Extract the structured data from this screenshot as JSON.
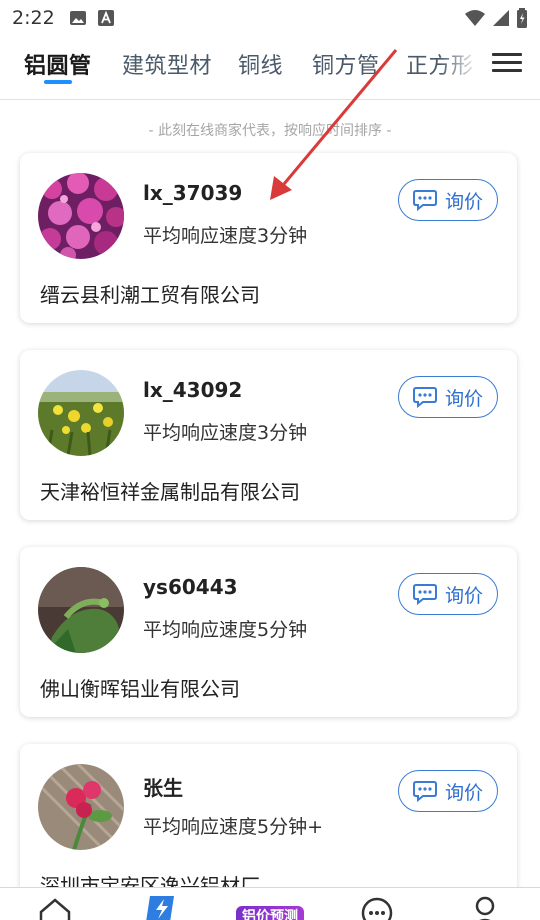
{
  "status_bar": {
    "time": "2:22"
  },
  "tabs": [
    {
      "label": "铝圆管",
      "active": true
    },
    {
      "label": "建筑型材",
      "active": false
    },
    {
      "label": "铜线",
      "active": false
    },
    {
      "label": "铜方管",
      "active": false
    },
    {
      "label": "正方形",
      "active": false
    }
  ],
  "section": {
    "subtitle": "- 此刻在线商家代表，按响应时间排序 -"
  },
  "merchants": [
    {
      "name": "lx_37039",
      "response_time": "平均响应速度3分钟",
      "company": "缙云县利潮工贸有限公司",
      "inquiry_label": "询价"
    },
    {
      "name": "lx_43092",
      "response_time": "平均响应速度3分钟",
      "company": "天津裕恒祥金属制品有限公司",
      "inquiry_label": "询价"
    },
    {
      "name": "ys60443",
      "response_time": "平均响应速度5分钟",
      "company": "佛山衡晖铝业有限公司",
      "inquiry_label": "询价"
    },
    {
      "name": "张生",
      "response_time": "平均响应速度5分钟+",
      "company": "深圳市宝安区逸兴铝材厂",
      "inquiry_label": "询价"
    }
  ],
  "bottom_nav": {
    "price_forecast_label": "铝价预测"
  },
  "colors": {
    "accent": "#1e90ff",
    "button_blue": "#3a7bd5",
    "badge_purple": "#8a34cc",
    "annotation_red": "#d93a3a"
  }
}
